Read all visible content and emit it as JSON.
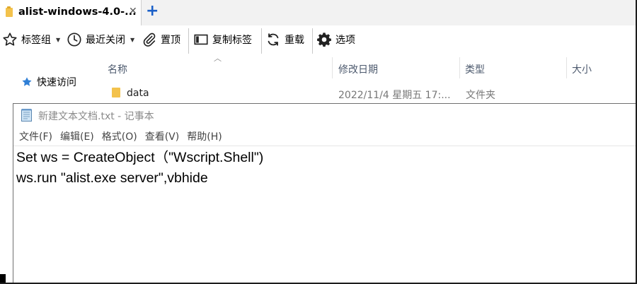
{
  "explorer": {
    "tab": {
      "title": "alist-windows-4.0-...",
      "close_glyph": "✕",
      "add_glyph": "+"
    },
    "toolbar": {
      "bookmark_group": "标签组",
      "recently_closed": "最近关闭",
      "pin": "置顶",
      "copy_tab": "复制标签",
      "reload": "重载",
      "options": "选项"
    },
    "nav": {
      "quick_access": "快速访问"
    },
    "columns": {
      "name": "名称",
      "modified": "修改日期",
      "type": "类型",
      "size": "大小"
    },
    "rows": [
      {
        "name": "data",
        "modified": "2022/11/4 星期五 17:...",
        "type": "文件夹"
      }
    ]
  },
  "notepad": {
    "title": "新建文本文档.txt - 记事本",
    "menu": [
      "文件(F)",
      "编辑(E)",
      "格式(O)",
      "查看(V)",
      "帮助(H)"
    ],
    "lines": [
      "Set ws = CreateObject（\"Wscript.Shell\")",
      "ws.run \"alist.exe server\",vbhide"
    ]
  },
  "icons": {
    "tab": "folder-icon",
    "bookmark_group": "star-icon",
    "recently_closed": "clock-icon",
    "pin": "paperclip-icon",
    "copy_tab": "window-copy-icon",
    "reload": "refresh-icon",
    "options": "gear-icon",
    "quick_access": "star-icon",
    "notepad": "notepad-icon"
  },
  "colors": {
    "accent": "#1a5fc8",
    "folder": "#f3c24c"
  }
}
